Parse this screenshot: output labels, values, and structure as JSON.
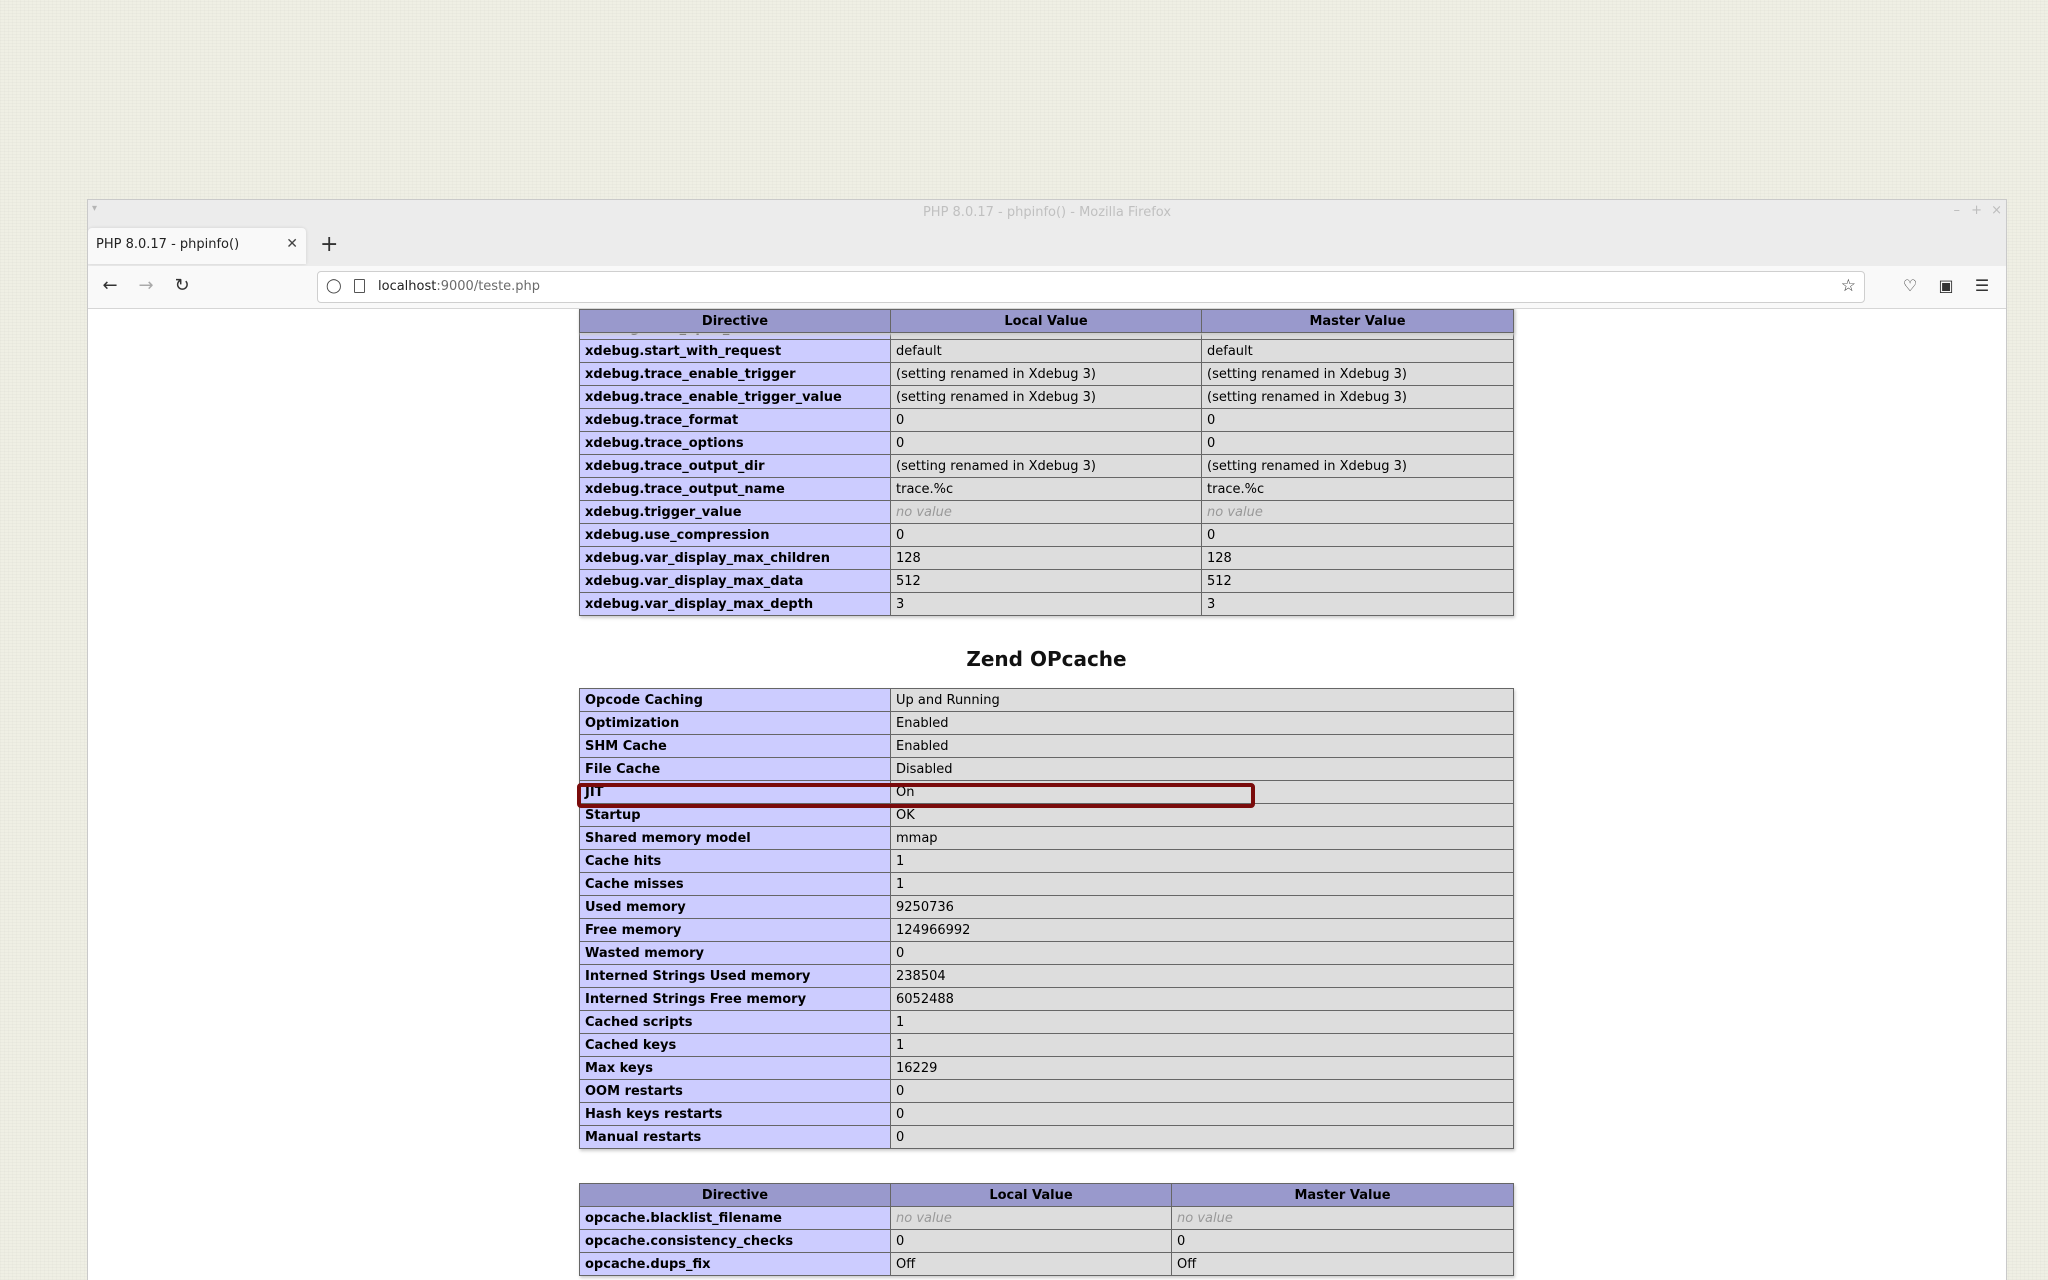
{
  "window": {
    "title": "PHP 8.0.17 - phpinfo() - Mozilla Firefox",
    "tab_title": "PHP 8.0.17 - phpinfo()",
    "url_host": "localhost",
    "url_rest": ":9000/teste.php"
  },
  "icons": {
    "back": "arrow-left-icon",
    "forward": "arrow-right-icon",
    "reload": "reload-icon",
    "shield": "shield-icon",
    "page": "page-icon",
    "bookmark": "star-icon",
    "pocket": "pocket-icon",
    "account": "account-icon",
    "menu": "hamburger-menu-icon"
  },
  "xdebug_table": {
    "headers": [
      "Directive",
      "Local Value",
      "Master Value"
    ],
    "rows": [
      [
        "xdebug.start_upon_error",
        "default",
        "default"
      ],
      [
        "xdebug.start_with_request",
        "default",
        "default"
      ],
      [
        "xdebug.trace_enable_trigger",
        "(setting renamed in Xdebug 3)",
        "(setting renamed in Xdebug 3)"
      ],
      [
        "xdebug.trace_enable_trigger_value",
        "(setting renamed in Xdebug 3)",
        "(setting renamed in Xdebug 3)"
      ],
      [
        "xdebug.trace_format",
        "0",
        "0"
      ],
      [
        "xdebug.trace_options",
        "0",
        "0"
      ],
      [
        "xdebug.trace_output_dir",
        "(setting renamed in Xdebug 3)",
        "(setting renamed in Xdebug 3)"
      ],
      [
        "xdebug.trace_output_name",
        "trace.%c",
        "trace.%c"
      ],
      [
        "xdebug.trigger_value",
        "no value",
        "no value"
      ],
      [
        "xdebug.use_compression",
        "0",
        "0"
      ],
      [
        "xdebug.var_display_max_children",
        "128",
        "128"
      ],
      [
        "xdebug.var_display_max_data",
        "512",
        "512"
      ],
      [
        "xdebug.var_display_max_depth",
        "3",
        "3"
      ]
    ]
  },
  "opcache_section": {
    "title": "Zend OPcache",
    "info_rows": [
      [
        "Opcode Caching",
        "Up and Running"
      ],
      [
        "Optimization",
        "Enabled"
      ],
      [
        "SHM Cache",
        "Enabled"
      ],
      [
        "File Cache",
        "Disabled"
      ],
      [
        "JIT",
        "On"
      ],
      [
        "Startup",
        "OK"
      ],
      [
        "Shared memory model",
        "mmap"
      ],
      [
        "Cache hits",
        "1"
      ],
      [
        "Cache misses",
        "1"
      ],
      [
        "Used memory",
        "9250736"
      ],
      [
        "Free memory",
        "124966992"
      ],
      [
        "Wasted memory",
        "0"
      ],
      [
        "Interned Strings Used memory",
        "238504"
      ],
      [
        "Interned Strings Free memory",
        "6052488"
      ],
      [
        "Cached scripts",
        "1"
      ],
      [
        "Cached keys",
        "1"
      ],
      [
        "Max keys",
        "16229"
      ],
      [
        "OOM restarts",
        "0"
      ],
      [
        "Hash keys restarts",
        "0"
      ],
      [
        "Manual restarts",
        "0"
      ]
    ],
    "directives_headers": [
      "Directive",
      "Local Value",
      "Master Value"
    ],
    "directives_rows": [
      [
        "opcache.blacklist_filename",
        "no value",
        "no value"
      ],
      [
        "opcache.consistency_checks",
        "0",
        "0"
      ],
      [
        "opcache.dups_fix",
        "Off",
        "Off"
      ]
    ]
  },
  "colors": {
    "header_bg": "#9999cc",
    "directive_bg": "#ccccff",
    "value_bg": "#dddddd",
    "highlight": "#7a0b0b"
  }
}
